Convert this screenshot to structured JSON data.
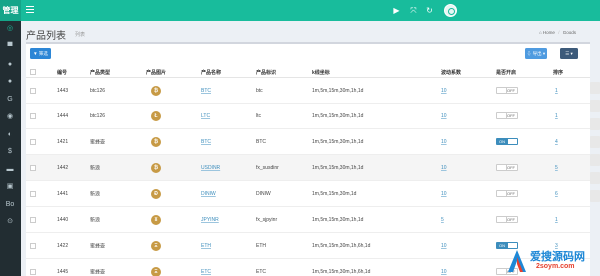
{
  "brand": "管理",
  "header": {
    "icons": [
      "play-icon",
      "expand-icon",
      "refresh-icon",
      "user-avatar-icon"
    ]
  },
  "sidebar": {
    "items": [
      "dashboard-icon",
      "home-icon",
      "user-icon",
      "group-icon",
      "g-icon",
      "dot-icon",
      "half-circle-icon",
      "dollar-icon",
      "card-icon",
      "image-icon",
      "bo-icon",
      "settings-icon"
    ],
    "bo_label": "Bo"
  },
  "page": {
    "title": "产品列表",
    "subtitle": "列表",
    "breadcrumb": {
      "home": "Home",
      "current": "Goods"
    }
  },
  "toolbar": {
    "filter_label": "筛选",
    "export_label": "导出",
    "export_caret": "▾",
    "columns_caret": "▾"
  },
  "table": {
    "columns": {
      "id": "编号",
      "type": "产品类型",
      "image": "产品图片",
      "name": "产品名称",
      "symbol": "产品标识",
      "kline": "k线坐标",
      "float": "波动系数",
      "enabled": "是否开启",
      "sort": "排序"
    },
    "rows": [
      {
        "id": "1443",
        "type": "btc126",
        "coin": "₿",
        "name": "BTC",
        "symbol": "btc",
        "kline": "1m,5m,15m,30m,1h,1d",
        "float": "10",
        "enabled": "OFF",
        "on": false,
        "sort": "1"
      },
      {
        "id": "1444",
        "type": "btc126",
        "coin": "Ł",
        "name": "LTC",
        "symbol": "ltc",
        "kline": "1m,5m,15m,30m,1h,1d",
        "float": "10",
        "enabled": "OFF",
        "on": false,
        "sort": "1"
      },
      {
        "id": "1421",
        "type": "蜜蜂壶",
        "coin": "₿",
        "name": "BTC",
        "symbol": "BTC",
        "kline": "1m,5m,15m,30m,1h,1d",
        "float": "10",
        "enabled": "ON",
        "on": true,
        "sort": "4"
      },
      {
        "id": "1442",
        "type": "新浪",
        "coin": "₿",
        "name": "USDINR",
        "symbol": "fx_susdinr",
        "kline": "1m,5m,15m,30m,1h,1d",
        "float": "10",
        "enabled": "OFF",
        "on": false,
        "sort": "5"
      },
      {
        "id": "1441",
        "type": "新浪",
        "coin": "Ð",
        "name": "DINIW",
        "symbol": "DINIW",
        "kline": "1m,5m,15m,30m,1d",
        "float": "10",
        "enabled": "OFF",
        "on": false,
        "sort": "6"
      },
      {
        "id": "1440",
        "type": "新浪",
        "coin": "¥",
        "name": "JPYINR",
        "symbol": "fx_sjpyinr",
        "kline": "1m,5m,15m,30m,1h,1d",
        "float": "5",
        "enabled": "OFF",
        "on": false,
        "sort": "1"
      },
      {
        "id": "1422",
        "type": "蜜蜂壶",
        "coin": "Ξ",
        "name": "ETH",
        "symbol": "ETH",
        "kline": "1m,5m,15m,30m,1h,6h,1d",
        "float": "10",
        "enabled": "ON",
        "on": true,
        "sort": "3"
      },
      {
        "id": "1445",
        "type": "蜜蜂壶",
        "coin": "Ξ",
        "name": "ETC",
        "symbol": "ETC",
        "kline": "1m,5m,15m,30m,1h,6h,1d",
        "float": "10",
        "enabled": "OFF",
        "on": false,
        "sort": ""
      }
    ]
  },
  "watermark": {
    "title": "爱搜源码网",
    "url": "2soym.com",
    "colors": {
      "blue": "#1e88d6",
      "red": "#e6412e"
    }
  },
  "colors": {
    "accent": "#18bc9c",
    "sidebar": "#222d32",
    "link": "#3c8dbc"
  }
}
